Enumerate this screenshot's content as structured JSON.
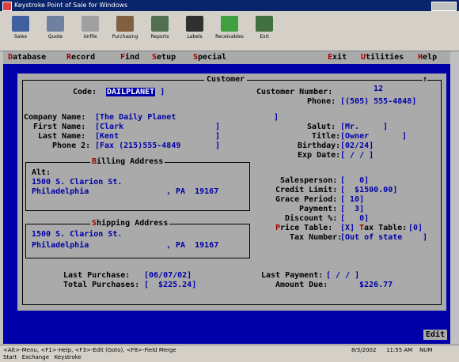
{
  "window": {
    "title": "Keystroke Point of Sale for Windows"
  },
  "toolbar": [
    {
      "label": "Sales",
      "name": "toolbar-sales",
      "color": "#4060a0"
    },
    {
      "label": "Quote",
      "name": "toolbar-quote",
      "color": "#7080a0"
    },
    {
      "label": "Unfile",
      "name": "toolbar-unfile",
      "color": "#a0a0a0"
    },
    {
      "label": "Purchasing",
      "name": "toolbar-purchasing",
      "color": "#806040"
    },
    {
      "label": "Reports",
      "name": "toolbar-reports",
      "color": "#507050"
    },
    {
      "label": "Labels",
      "name": "toolbar-labels",
      "color": "#303030"
    },
    {
      "label": "Receivables",
      "name": "toolbar-receivables",
      "color": "#40a040"
    },
    {
      "label": "Exit",
      "name": "toolbar-exit",
      "color": "#407040"
    }
  ],
  "menu": {
    "left": [
      {
        "hk": "D",
        "rest": "atabase"
      },
      {
        "hk": "R",
        "rest": "ecord"
      },
      {
        "hk": "F",
        "rest": "ind"
      },
      {
        "hk": "S",
        "rest": "etup"
      },
      {
        "hk": "S",
        "rest": "pecial"
      }
    ],
    "right": [
      {
        "hk": "E",
        "rest": "xit"
      },
      {
        "hk": "U",
        "rest": "tilities"
      },
      {
        "hk": "H",
        "rest": "elp"
      }
    ]
  },
  "customer": {
    "title": "Customer",
    "close": "↑",
    "code_label": "Code:",
    "code_value": "DAILPLANET",
    "number_label": "Customer Number:",
    "number_value": "12",
    "phone_label": "Phone:",
    "phone_value": "[(505) 555-4848]",
    "company_label": "Company Name:",
    "company_value": "[The Daily Planet",
    "first_label": "First Name:",
    "first_value": "[Clark",
    "last_label": "Last Name:",
    "last_value": "[Kent",
    "phone2_label": "Phone 2:",
    "phone2_value": "[Fax (215)555-4849",
    "salut_label": "Salut:",
    "salut_value": "[Mr.",
    "title_label": "Title:",
    "title_value": "[Owner",
    "birthday_label": "Birthday:",
    "birthday_value": "[02/24]",
    "exp_label": "Exp Date:",
    "exp_value": "[ / / ]",
    "billing_title": "Billing Address",
    "alt_label": "Alt:",
    "bill_street": "1500 S. Clarion St.",
    "bill_city": "Philadelphia",
    "bill_state": ", PA  19167",
    "shipping_title": "Shipping Address",
    "ship_street": "1500 S. Clarion St.",
    "ship_city": "Philadelphia",
    "ship_state": ", PA  19167",
    "salesperson_label": "Salesperson:",
    "salesperson_value": "[   0]",
    "credit_label": "Credit Limit:",
    "credit_value": "[  $1500.00]",
    "grace_label": "Grace Period:",
    "grace_value": "[ 10]",
    "payment_label": "Payment:",
    "payment_value": "[  3]",
    "discount_label": "Discount %:",
    "discount_value": "[   0]",
    "price_label": "Price Table:",
    "price_value": "[X]",
    "tax_table_label": "Tax Table:",
    "tax_table_value": "[0]",
    "tax_number_label": "Tax Number:",
    "tax_number_value": "[Out of state",
    "last_purchase_label": "Last Purchase:",
    "last_purchase_value": "[06/07/02]",
    "total_label": "Total Purchases:",
    "total_value": "[  $225.24]",
    "last_payment_label": "Last Payment:",
    "last_payment_value": "[ / / ]",
    "amount_due_label": "Amount Due:",
    "amount_due_value": "$226.77"
  },
  "mode": "Edit",
  "statusbar": {
    "hints": "<Alt>-Menu, <F1>-Help, <F3>-Edit (Goto), <F8>-Field Merge",
    "date": "8/3/2002",
    "time": "11:55 AM",
    "num": "NUM",
    "taskbar": "Start   Exchange   Keystroke"
  },
  "colors": {
    "dos_blue": "#0000a8",
    "panel_gray": "#aaaaaa",
    "hotkey_red": "#a00000"
  }
}
